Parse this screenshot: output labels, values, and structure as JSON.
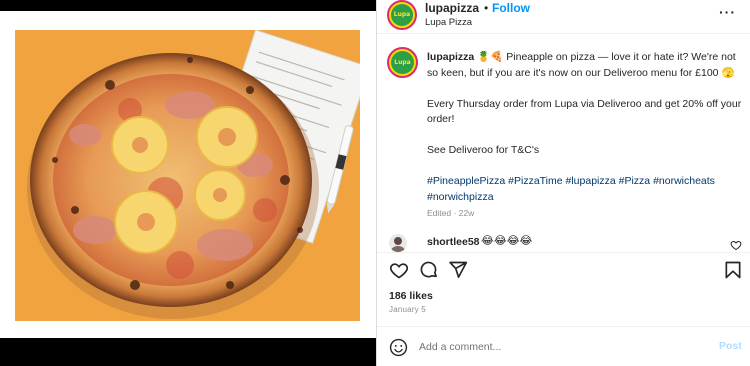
{
  "post": {
    "username": "lupapizza",
    "separator": "•",
    "follow_label": "Follow",
    "location": "Lupa Pizza",
    "more_label": "···",
    "avatar_text": "Lupa",
    "caption_emoji": "🍍🍕",
    "caption_line1": "Pineapple on pizza — love it or hate it? We're not so keen, but if you are it's now on our Deliveroo menu for £100",
    "caption_line1_emoji": "🫣",
    "caption_line2": "Every Thursday order from Lupa via Deliveroo and get 20% off your order!",
    "caption_line3": "See Deliveroo for T&C's",
    "hashtags": "#PineapplePizza #PizzaTime #lupapizza #Pizza #norwicheats #norwichpizza",
    "edited": "Edited · 22w",
    "likes": "186 likes",
    "date": "January 5"
  },
  "comment": {
    "username": "shortlee58",
    "text": "😂😂😂😂"
  },
  "actions": {
    "like_icon": "heart-icon",
    "comment_icon": "comment-icon",
    "share_icon": "share-icon",
    "save_icon": "bookmark-icon"
  },
  "add_comment": {
    "placeholder": "Add a comment...",
    "post_label": "Post"
  },
  "colors": {
    "follow": "#0095f6",
    "hashtag": "#00376b",
    "photo_background": "#f0a33e",
    "brand_green": "#2e9e47",
    "brand_yellow": "#f9e43a"
  }
}
